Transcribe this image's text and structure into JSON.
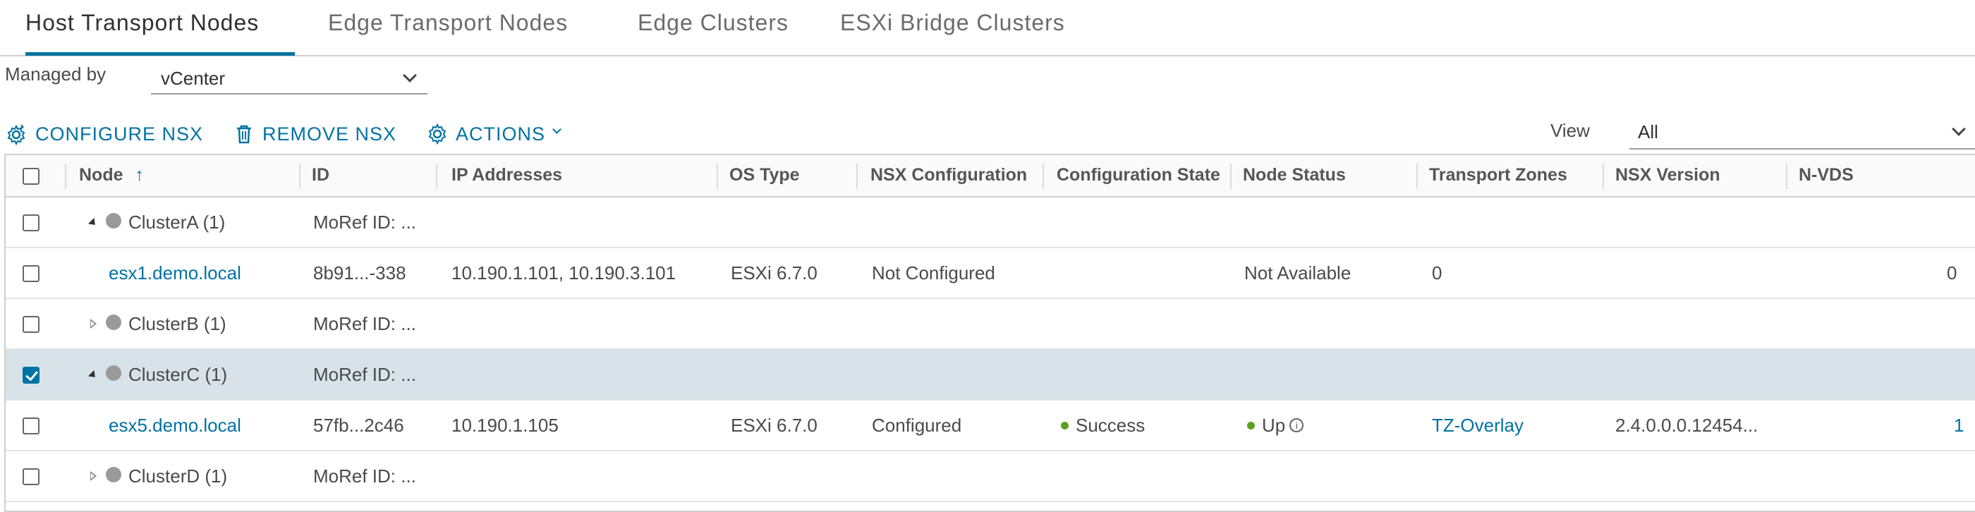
{
  "tabs": [
    {
      "label": "Host Transport Nodes",
      "active": true
    },
    {
      "label": "Edge Transport Nodes",
      "active": false
    },
    {
      "label": "Edge Clusters",
      "active": false
    },
    {
      "label": "ESXi Bridge Clusters",
      "active": false
    }
  ],
  "filter": {
    "managed_by_label": "Managed by",
    "managed_by_value": "vCenter",
    "view_label": "View",
    "view_value": "All"
  },
  "toolbar": {
    "configure_label": "CONFIGURE NSX",
    "remove_label": "REMOVE NSX",
    "actions_label": "ACTIONS"
  },
  "table": {
    "columns": [
      "Node",
      "ID",
      "IP Addresses",
      "OS Type",
      "NSX Configuration",
      "Configuration State",
      "Node Status",
      "Transport Zones",
      "NSX Version",
      "N-VDS"
    ],
    "sort_indicator": "↑",
    "rows": [
      {
        "type": "cluster",
        "expanded": true,
        "checked": false,
        "node": "ClusterA (1)",
        "id": "MoRef ID: ..."
      },
      {
        "type": "host",
        "checked": false,
        "node": "esx1.demo.local",
        "id": "8b91...-338",
        "ip": "10.190.1.101, 10.190.3.101",
        "os": "ESXi 6.7.0",
        "nsx_config": "Not Configured",
        "config_state": "",
        "node_status": "Not Available",
        "transport_zones": "0",
        "nsx_version": "",
        "nvds": "0"
      },
      {
        "type": "cluster",
        "expanded": false,
        "checked": false,
        "node": "ClusterB (1)",
        "id": "MoRef ID: ..."
      },
      {
        "type": "cluster",
        "expanded": true,
        "checked": true,
        "node": "ClusterC (1)",
        "id": "MoRef ID: ..."
      },
      {
        "type": "host",
        "checked": false,
        "node": "esx5.demo.local",
        "id": "57fb...2c46",
        "ip": "10.190.1.105",
        "os": "ESXi 6.7.0",
        "nsx_config": "Configured",
        "config_state": "Success",
        "node_status": "Up",
        "transport_zones": "TZ-Overlay",
        "nsx_version": "2.4.0.0.0.12454...",
        "nvds": "1"
      },
      {
        "type": "cluster",
        "expanded": false,
        "checked": false,
        "node": "ClusterD (1)",
        "id": "MoRef ID: ..."
      }
    ]
  },
  "colors": {
    "accent": "#0072a3",
    "status_green": "#5aa220",
    "selected_row": "#d8e3e9"
  }
}
